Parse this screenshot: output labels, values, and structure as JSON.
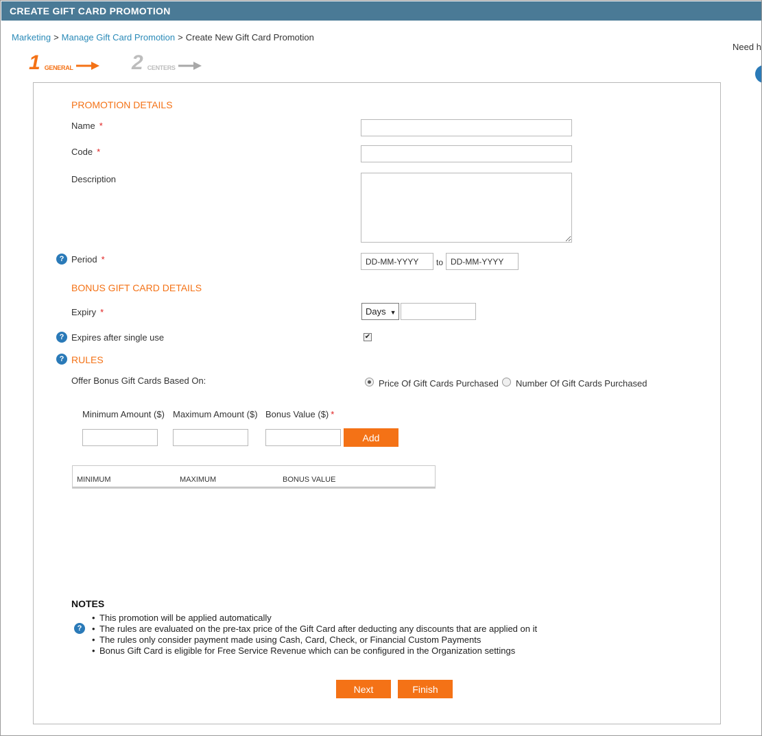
{
  "window": {
    "title": "CREATE GIFT CARD PROMOTION"
  },
  "breadcrumb": {
    "items": [
      "Marketing",
      "Manage Gift Card Promotion",
      "Create New Gift Card Promotion"
    ],
    "separator": ">"
  },
  "need_help": "Need he",
  "steps": [
    {
      "number": "1",
      "label": "GENERAL",
      "active": true
    },
    {
      "number": "2",
      "label": "CENTERS",
      "active": false
    }
  ],
  "promotion_details": {
    "heading": "PROMOTION DETAILS",
    "name_label": "Name",
    "code_label": "Code",
    "description_label": "Description",
    "period_label": "Period",
    "required_mark": "*",
    "name_value": "",
    "code_value": "",
    "description_value": "",
    "period_from_placeholder": "DD-MM-YYYY",
    "period_to_label": "to",
    "period_to_placeholder": "DD-MM-YYYY"
  },
  "bonus_details": {
    "heading": "BONUS GIFT CARD DETAILS",
    "expiry_label": "Expiry",
    "expiry_unit_selected": "Days",
    "expiry_value": "",
    "single_use_label": "Expires after single use",
    "single_use_checked": true
  },
  "rules": {
    "heading": "RULES",
    "based_on_label": "Offer Bonus Gift Cards Based On:",
    "options": [
      {
        "label": "Price Of Gift Cards Purchased",
        "selected": true
      },
      {
        "label": "Number Of Gift Cards Purchased",
        "selected": false
      }
    ],
    "min_label": "Minimum Amount ($)",
    "max_label": "Maximum Amount ($)",
    "bonus_label": "Bonus Value ($)",
    "add_button": "Add",
    "table_columns": [
      "MINIMUM",
      "MAXIMUM",
      "BONUS VALUE"
    ]
  },
  "notes": {
    "title": "NOTES",
    "items": [
      "This promotion will be applied automatically",
      "The rules are evaluated on the pre-tax price of the Gift Card after deducting any discounts that are applied on it",
      "The rules only consider payment made using Cash, Card, Check, or Financial Custom Payments",
      "Bonus Gift Card is eligible for Free Service Revenue which can be configured in the Organization settings"
    ]
  },
  "actions": {
    "next_button": "Next",
    "finish_button": "Finish"
  },
  "colors": {
    "header": "#4a7a96",
    "accent": "#f47216",
    "link": "#2a8ab8",
    "help": "#2a7ab8"
  },
  "icons": {
    "help": "question-circle-icon",
    "step_arrow": "arrow-right-icon",
    "checkbox": "checkmark-icon"
  }
}
